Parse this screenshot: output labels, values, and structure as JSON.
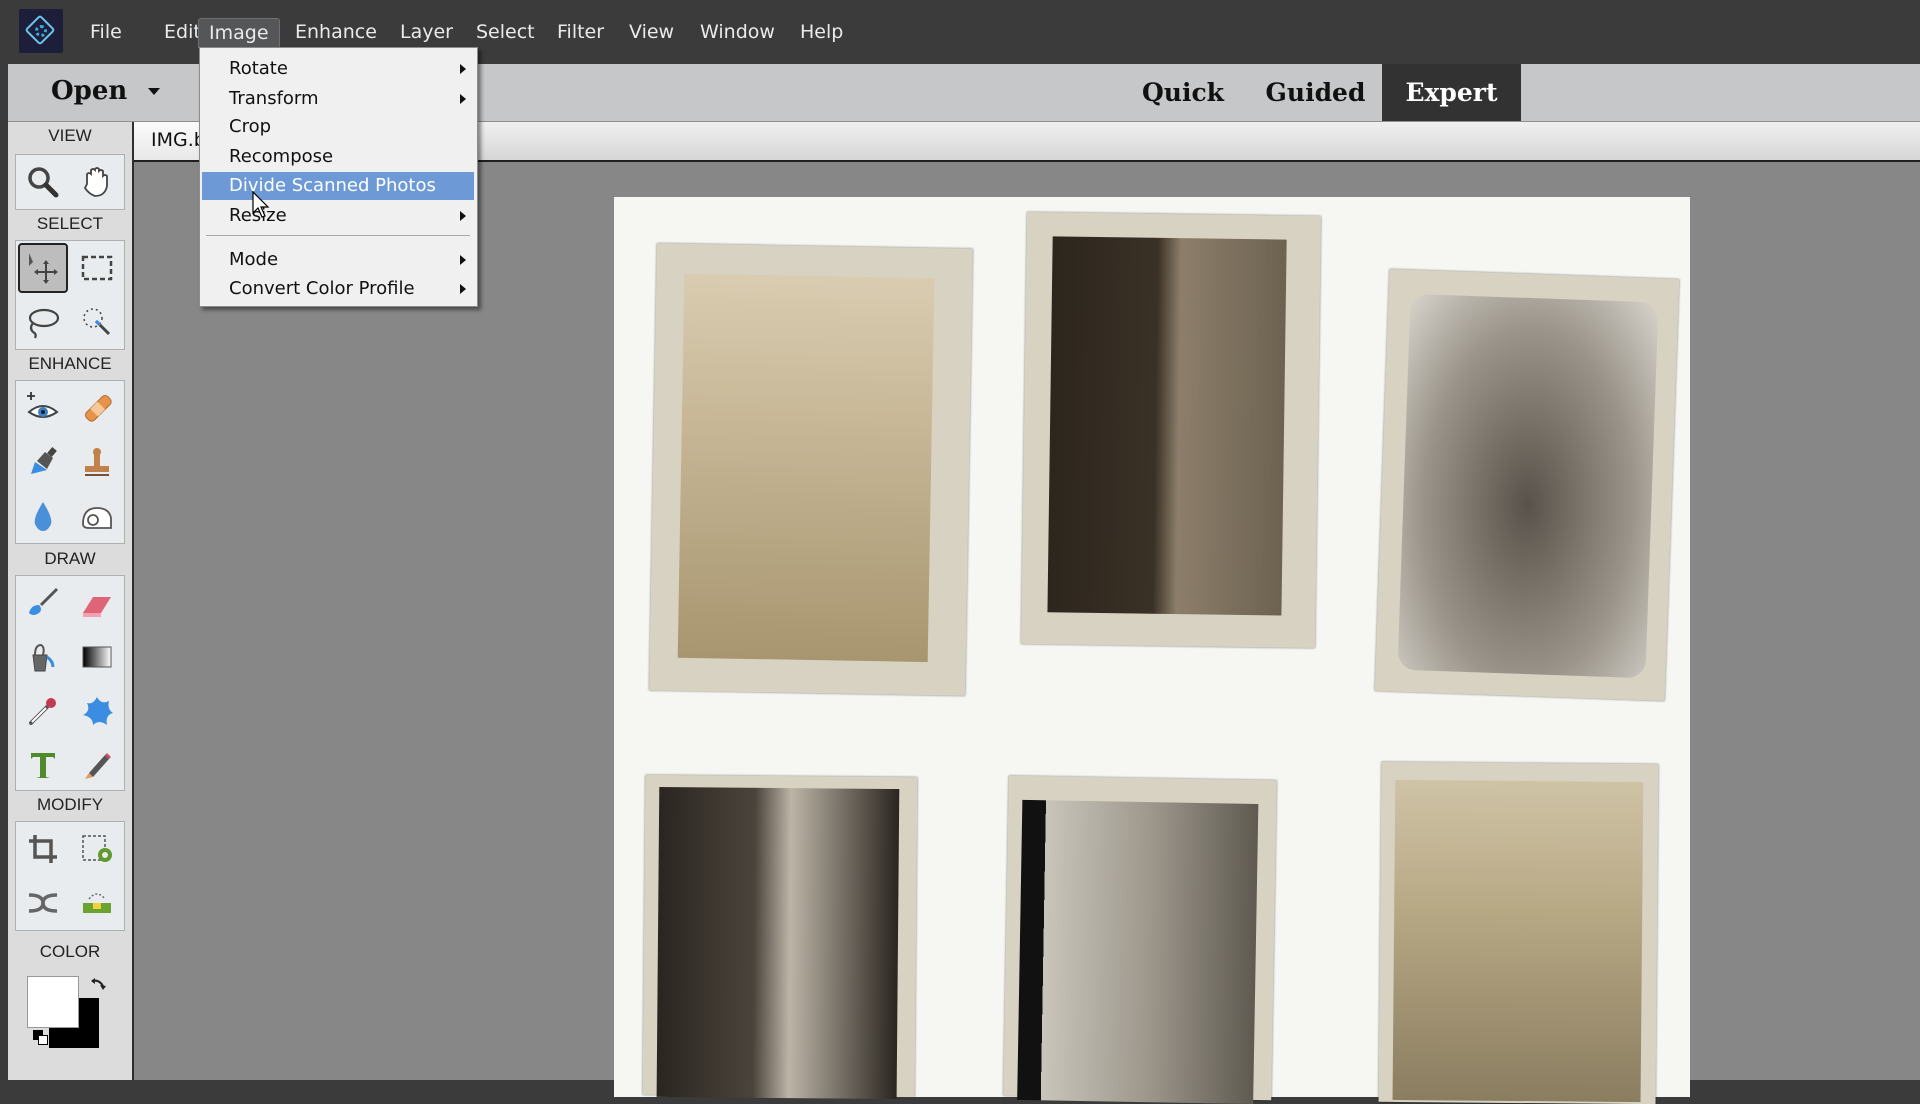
{
  "menubar": {
    "logo": "photoshop-elements-logo",
    "items": [
      "File",
      "Edit",
      "Image",
      "Enhance",
      "Layer",
      "Select",
      "Filter",
      "View",
      "Window",
      "Help"
    ],
    "active_item": "Image"
  },
  "header": {
    "open_label": "Open",
    "mode_tabs": [
      "Quick",
      "Guided",
      "Expert"
    ],
    "active_mode": "Expert"
  },
  "document": {
    "tab_label": "IMG.b"
  },
  "toolpanel": {
    "sections": [
      {
        "label": "VIEW",
        "tools": [
          "zoom-tool",
          "hand-tool"
        ]
      },
      {
        "label": "SELECT",
        "tools": [
          "move-tool",
          "marquee-tool",
          "lasso-tool",
          "quick-selection-tool"
        ]
      },
      {
        "label": "ENHANCE",
        "tools": [
          "red-eye-tool",
          "spot-healing-tool",
          "smart-brush-tool",
          "clone-stamp-tool",
          "blur-tool",
          "sponge-tool"
        ]
      },
      {
        "label": "DRAW",
        "tools": [
          "brush-tool",
          "eraser-tool",
          "paint-bucket-tool",
          "gradient-tool",
          "eyedropper-tool",
          "custom-shape-tool",
          "type-tool",
          "pencil-tool"
        ]
      },
      {
        "label": "MODIFY",
        "tools": [
          "crop-tool",
          "recompose-tool",
          "content-aware-move-tool",
          "straighten-tool"
        ]
      },
      {
        "label": "COLOR",
        "tools": []
      }
    ],
    "selected_tool": "move-tool",
    "foreground_color": "#ffffff",
    "background_color": "#000000"
  },
  "image_menu": {
    "items": [
      {
        "label": "Rotate",
        "submenu": true
      },
      {
        "label": "Transform",
        "submenu": true
      },
      {
        "label": "Crop",
        "submenu": false
      },
      {
        "label": "Recompose",
        "submenu": false
      },
      {
        "label": "Divide Scanned Photos",
        "submenu": false,
        "highlighted": true
      },
      {
        "label": "Resize",
        "submenu": true
      },
      {
        "label": "Mode",
        "submenu": true
      },
      {
        "label": "Convert Color Profile",
        "submenu": true
      }
    ]
  },
  "colors": {
    "highlight": "#6d9ad6",
    "menubar_bg": "#3b3b3b",
    "canvas_bg": "#878787"
  }
}
